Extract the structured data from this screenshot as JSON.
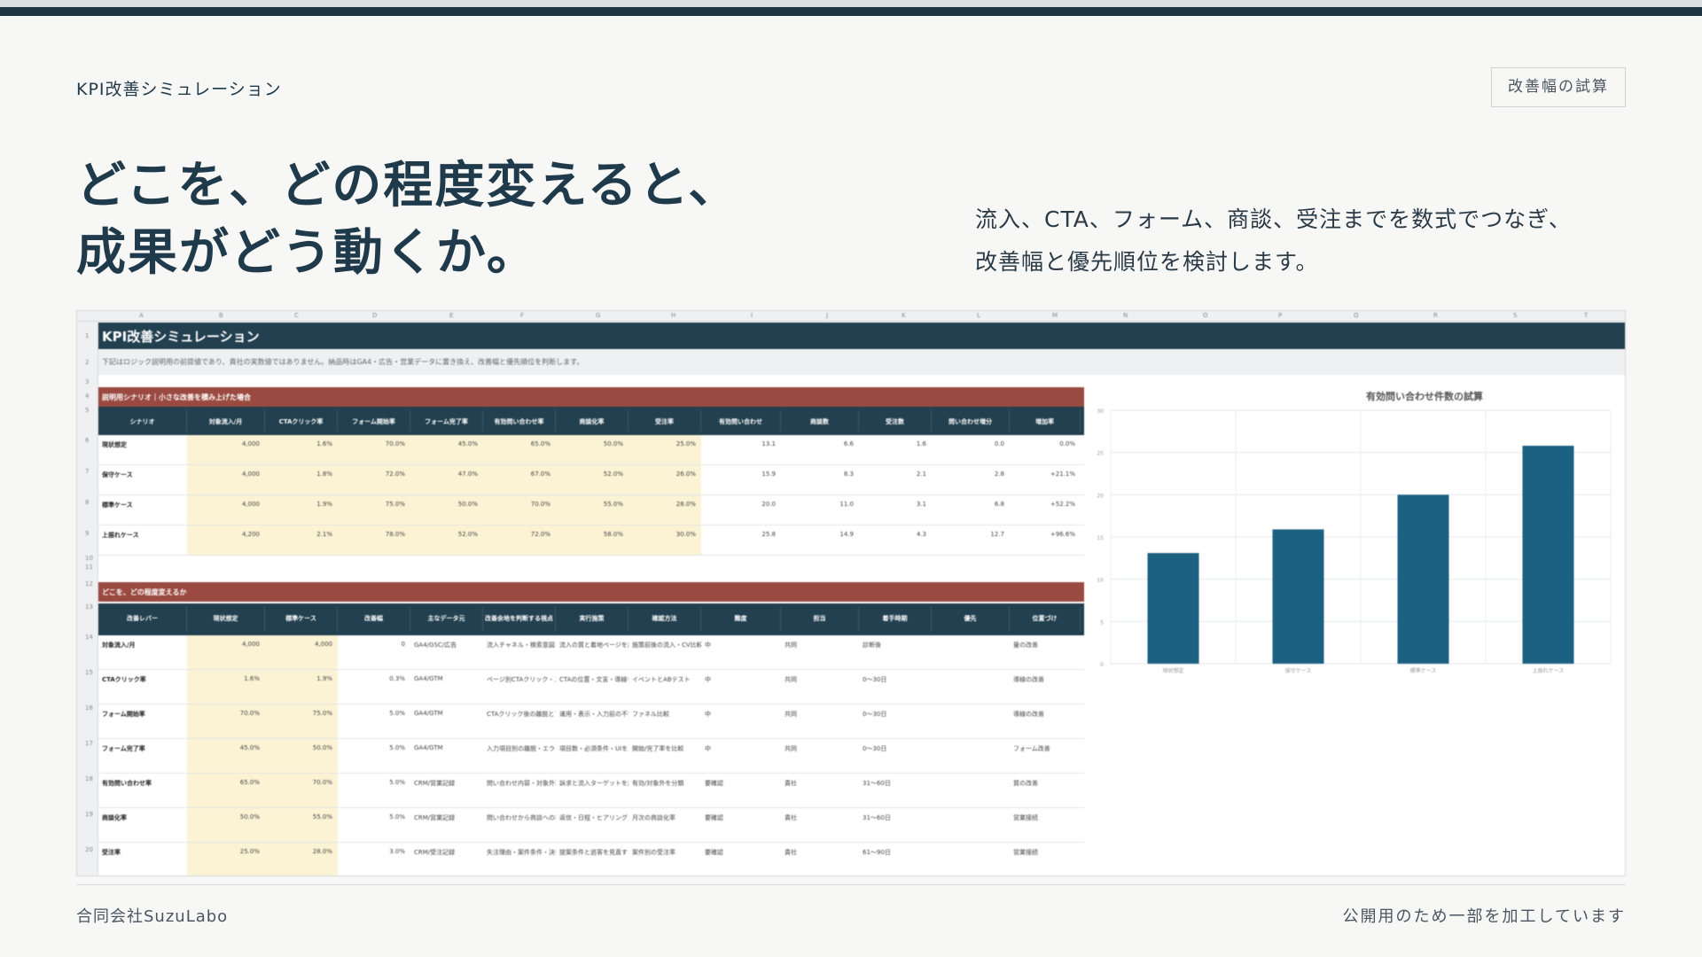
{
  "header": {
    "eyebrow": "KPI改善シミュレーション",
    "badge": "改善幅の試算"
  },
  "headline": {
    "line1": "どこを、どの程度変えると、",
    "line2": "成果がどう動くか。"
  },
  "lead": {
    "line1": "流入、CTA、フォーム、商談、受注までを数式でつなぎ、",
    "line2": "改善幅と優先順位を検討します。"
  },
  "sheet": {
    "columns": [
      "A",
      "B",
      "C",
      "D",
      "E",
      "F",
      "G",
      "H",
      "I",
      "J",
      "K",
      "L",
      "M",
      "N",
      "O",
      "P",
      "Q",
      "R",
      "S",
      "T"
    ],
    "rows": [
      "1",
      "2",
      "3",
      "4",
      "5",
      "6",
      "7",
      "8",
      "9",
      "10",
      "11",
      "12",
      "13",
      "14",
      "15",
      "16",
      "17",
      "18",
      "19",
      "20"
    ],
    "title": "KPI改善シミュレーション",
    "note": "下記はロジック説明用の前提値であり、貴社の実数値ではありません。納品時はGA4・広告・営業データに置き換え、改善幅と優先順位を判断します。",
    "section1": {
      "label": "説明用シナリオ｜小さな改善を積み上げた場合",
      "headers": [
        "シナリオ",
        "対象流入/月",
        "CTAクリック率",
        "フォーム開始率",
        "フォーム完了率",
        "有効問い合わせ率",
        "商談化率",
        "受注率",
        "有効問い合わせ",
        "商談数",
        "受注数",
        "問い合わせ増分",
        "増加率"
      ],
      "rows": [
        [
          "現状想定",
          "4,000",
          "1.6%",
          "70.0%",
          "45.0%",
          "65.0%",
          "50.0%",
          "25.0%",
          "13.1",
          "6.6",
          "1.6",
          "0.0",
          "0.0%"
        ],
        [
          "保守ケース",
          "4,000",
          "1.8%",
          "72.0%",
          "47.0%",
          "67.0%",
          "52.0%",
          "26.0%",
          "15.9",
          "8.3",
          "2.1",
          "2.8",
          "+21.1%"
        ],
        [
          "標準ケース",
          "4,000",
          "1.9%",
          "75.0%",
          "50.0%",
          "70.0%",
          "55.0%",
          "28.0%",
          "20.0",
          "11.0",
          "3.1",
          "6.8",
          "+52.2%"
        ],
        [
          "上振れケース",
          "4,200",
          "2.1%",
          "78.0%",
          "52.0%",
          "72.0%",
          "58.0%",
          "30.0%",
          "25.8",
          "14.9",
          "4.3",
          "12.7",
          "+96.6%"
        ]
      ]
    },
    "section2": {
      "label": "どこを、どの程度変えるか",
      "headers": [
        "改善レバー",
        "現状想定",
        "標準ケース",
        "改善幅",
        "主なデータ元",
        "改善余地を判断する視点",
        "実行施策",
        "確認方法",
        "難度",
        "担当",
        "着手時期",
        "優先",
        "位置づけ"
      ],
      "rows": [
        [
          "対象流入/月",
          "4,000",
          "4,000",
          "0",
          "GA4/GSC/広告",
          "流入チャネル・検索意図・広告語句",
          "流入の質と着地ページを調整",
          "施策前後の流入・CV比較",
          "中",
          "共同",
          "診断後",
          "",
          "量の改善"
        ],
        [
          "CTAクリック率",
          "1.6%",
          "1.9%",
          "0.3%",
          "GA4/GTM",
          "ページ別CTAクリック・スクロール・導線",
          "CTAの位置・文言・導線を再検証",
          "イベントとABテスト",
          "中",
          "共同",
          "0〜30日",
          "",
          "導線の改善"
        ],
        [
          "フォーム開始率",
          "70.0%",
          "75.0%",
          "5.0%",
          "GA4/GTM",
          "CTAクリック後の離脱とフォーム到達",
          "運用・表示・入力前の不安を低減",
          "ファネル比較",
          "中",
          "共同",
          "0〜30日",
          "",
          "導線の改善"
        ],
        [
          "フォーム完了率",
          "45.0%",
          "50.0%",
          "5.0%",
          "GA4/GTM",
          "入力項目別の離脱・エラー",
          "項目数・必須条件・UIを見直す",
          "開始/完了率を比較",
          "中",
          "共同",
          "0〜30日",
          "",
          "フォーム改善"
        ],
        [
          "有効問い合わせ率",
          "65.0%",
          "70.0%",
          "5.0%",
          "CRM/営業記録",
          "問い合わせ内容・対象外理由",
          "訴求と流入ターゲットを調整",
          "有効/対象外を分類",
          "要確認",
          "貴社",
          "31〜60日",
          "",
          "質の改善"
        ],
        [
          "商談化率",
          "50.0%",
          "55.0%",
          "5.0%",
          "CRM/営業記録",
          "問い合わせから商談への移行理由",
          "返信・日程・ヒアリングを改善",
          "月次の商談化率",
          "要確認",
          "貴社",
          "31〜60日",
          "",
          "営業接続"
        ],
        [
          "受注率",
          "25.0%",
          "28.0%",
          "3.0%",
          "CRM/受注記録",
          "失注理由・案件条件・決裁期間",
          "提案条件と追客を見直す",
          "案件別の受注率",
          "要確認",
          "貴社",
          "61〜90日",
          "",
          "営業接続"
        ]
      ]
    }
  },
  "chart_data": {
    "type": "bar",
    "title": "有効問い合わせ件数の試算",
    "categories": [
      "現状想定",
      "保守ケース",
      "標準ケース",
      "上振れケース"
    ],
    "values": [
      13.1,
      15.9,
      20.0,
      25.8
    ],
    "ylim": [
      0,
      30
    ],
    "yticks": [
      0,
      5,
      10,
      15,
      20,
      25,
      30
    ],
    "grid": true,
    "color": "#1c6082"
  },
  "footer": {
    "company": "合同会社SuzuLabo",
    "disclaimer": "公開用のため一部を加工しています"
  }
}
